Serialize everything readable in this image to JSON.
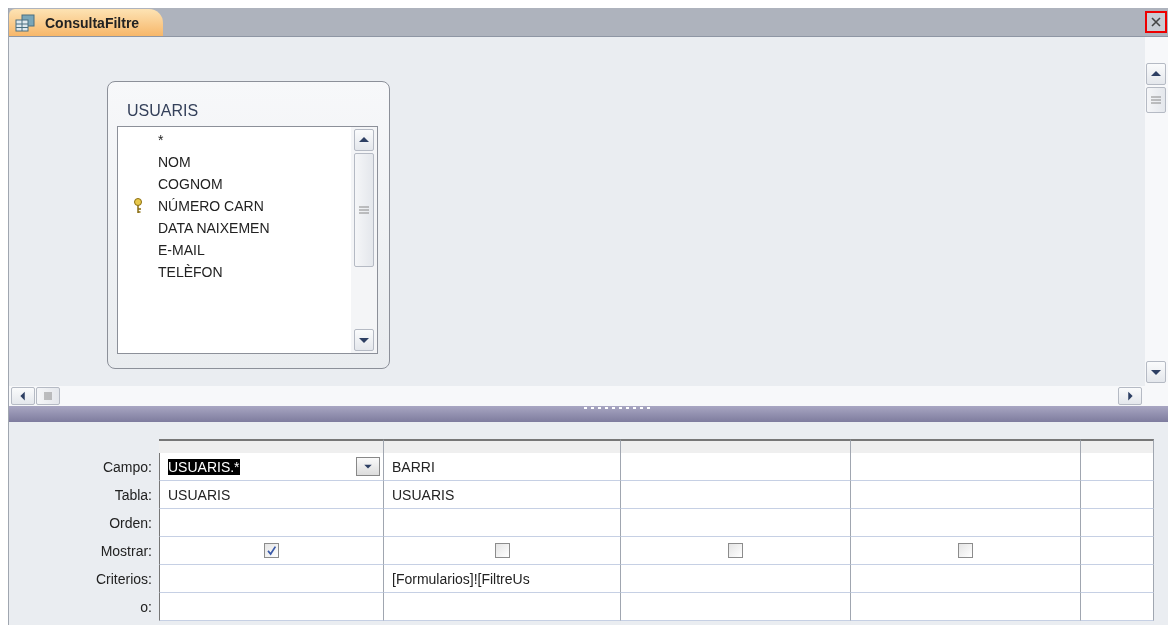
{
  "tab": {
    "title": "ConsultaFiltre",
    "selected": true
  },
  "table_box": {
    "title": "USUARIS",
    "fields": [
      {
        "name": "*",
        "primary_key": false
      },
      {
        "name": "NOM",
        "primary_key": false
      },
      {
        "name": "COGNOM",
        "primary_key": false
      },
      {
        "name": "NÚMERO CARN",
        "primary_key": true
      },
      {
        "name": "DATA NAIXEMEN",
        "primary_key": false
      },
      {
        "name": "E-MAIL",
        "primary_key": false
      },
      {
        "name": "TELÈFON",
        "primary_key": false
      }
    ]
  },
  "grid": {
    "row_labels": [
      "Campo:",
      "Tabla:",
      "Orden:",
      "Mostrar:",
      "Criterios:",
      "o:"
    ],
    "columns": [
      {
        "field": "USUARIS.*",
        "field_selected": true,
        "table": "USUARIS",
        "show": true
      },
      {
        "field": "BARRI",
        "field_selected": false,
        "table": "USUARIS",
        "show": false,
        "criteria": "[Formularios]![FiltreUs"
      },
      {
        "field_selected": false,
        "show": false
      },
      {
        "field_selected": false,
        "show": false
      },
      {
        "field_selected": false
      }
    ]
  }
}
